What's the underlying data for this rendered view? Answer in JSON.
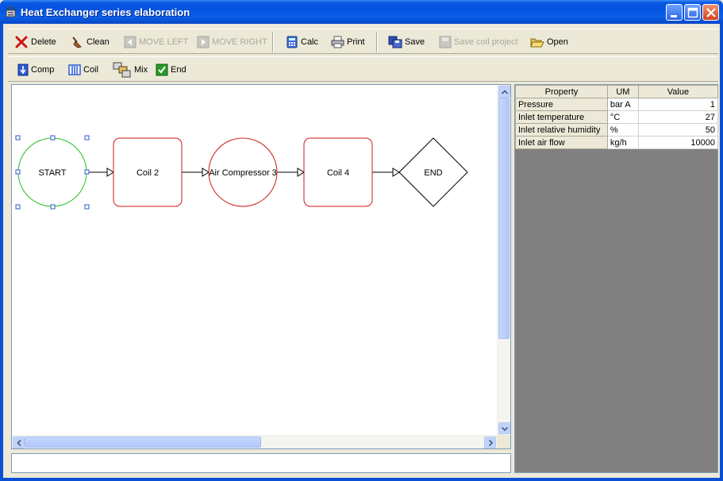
{
  "window": {
    "title": "Heat Exchanger series elaboration"
  },
  "toolbar_main": {
    "delete": "Delete",
    "clean": "Clean",
    "move_left": "MOVE LEFT",
    "move_right": "MOVE RIGHT",
    "calc": "Calc",
    "print": "Print",
    "save": "Save",
    "save_coil_project": "Save coil project",
    "open": "Open"
  },
  "toolbar_components": {
    "comp": "Comp",
    "coil": "Coil",
    "mix": "Mix",
    "end": "End"
  },
  "diagram": {
    "nodes": [
      {
        "id": "start",
        "shape": "circle",
        "label": "START",
        "selected": true
      },
      {
        "id": "coil2",
        "shape": "rounded-rect",
        "label": "Coil 2"
      },
      {
        "id": "comp3",
        "shape": "circle",
        "label": "Air Compressor 3"
      },
      {
        "id": "coil4",
        "shape": "rounded-rect",
        "label": "Coil 4"
      },
      {
        "id": "end",
        "shape": "diamond",
        "label": "END"
      }
    ]
  },
  "properties": {
    "headers": {
      "property": "Property",
      "um": "UM",
      "value": "Value"
    },
    "rows": [
      {
        "property": "Pressure",
        "um": "bar A",
        "value": "1"
      },
      {
        "property": "Inlet temperature",
        "um": "°C",
        "value": "27"
      },
      {
        "property": "Inlet relative humidity",
        "um": "%",
        "value": "50"
      },
      {
        "property": "Inlet air flow",
        "um": "kg/h",
        "value": "10000"
      }
    ]
  },
  "colors": {
    "title_bar": "#0553de",
    "node_selected": "#22c022",
    "node_default": "#d01818"
  }
}
